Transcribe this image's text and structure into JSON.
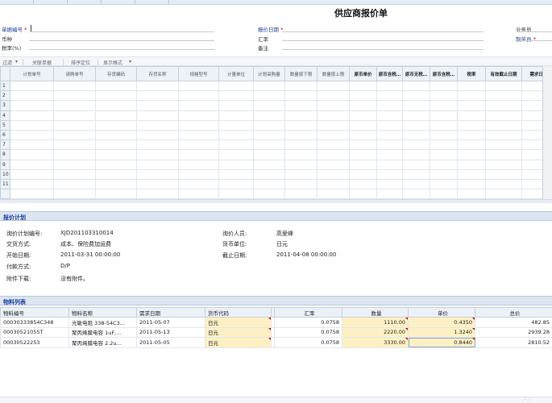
{
  "page_title": "供应商报价单",
  "form": {
    "bill_no_label": "单据编号",
    "currency_label": "币种",
    "tax_rate_label": "税率(%)",
    "quote_date_label": "报价日期",
    "exchange_rate_label": "汇率",
    "remark_label": "备注",
    "salesman_label": "业务员",
    "dept_label": "制单员",
    "required_mark": "*"
  },
  "toolbar": {
    "filter": "过滤",
    "link_bill": "关联单据",
    "sort": "排序定位",
    "display": "显示格式"
  },
  "grid": {
    "columns": [
      "计划单号",
      "请购单号",
      "存货编码",
      "存货名称",
      "规格型号",
      "计量单位",
      "计划采购量",
      "数量按下限",
      "数量按上限",
      "原币单价",
      "原币含税…",
      "原币无税…",
      "原币含税…",
      "税率",
      "有效截止日期",
      "需求日期"
    ],
    "bold_from": 9,
    "row_numbers": [
      "1",
      "2",
      "3",
      "4",
      "5",
      "6",
      "7",
      "8",
      "9",
      "10",
      "11",
      ""
    ]
  },
  "plan_panel": {
    "title": "报价计划",
    "plan_no_label": "询价计划编号:",
    "plan_no": "XJD201103310014",
    "trade_terms_label": "交货方式:",
    "trade_terms": "成本、保险费加运费",
    "start_date_label": "开始日期:",
    "start_date": "2011-03-31 00:00:00",
    "payment_label": "付款方式:",
    "payment": "D/P",
    "attachment_label": "附件下载:",
    "attachment": "没有附件。",
    "inquirer_label": "询价人员:",
    "inquirer": "高爱峰",
    "currency_unit_label": "货币单位:",
    "currency_unit": "日元",
    "deadline_label": "截止日期:",
    "deadline": "2011-04-08 00:00:00"
  },
  "material_panel": {
    "title": "物料列表",
    "headers": [
      "物料编号",
      "物料名称",
      "需求日期",
      "货币代码",
      "",
      "汇率",
      "数量",
      "单价",
      "总价"
    ],
    "rows": [
      [
        "00030333854C348",
        "光敏电阻 338-54C3…",
        "2011-05-07",
        "日元",
        "",
        "0.0758",
        "1110.00",
        "0.4350",
        "482.85"
      ],
      [
        "00030521055T",
        "聚丙烯膜电容 1uF,…",
        "2011-05-13",
        "日元",
        "",
        "0.0758",
        "2220.00",
        "1.3240",
        "2939.28"
      ],
      [
        "00030522253",
        "聚丙烯膜电容 2.2u…",
        "2011-05-05",
        "日元",
        "",
        "0.0758",
        "3330.00",
        "0.8440",
        "2810.52"
      ]
    ]
  },
  "colors": {
    "header_blue": "#1d3f9a",
    "required_red": "#dd0000",
    "editable_yellow": "#fdf1c4",
    "panel_header_bg": "#dce6f1"
  }
}
